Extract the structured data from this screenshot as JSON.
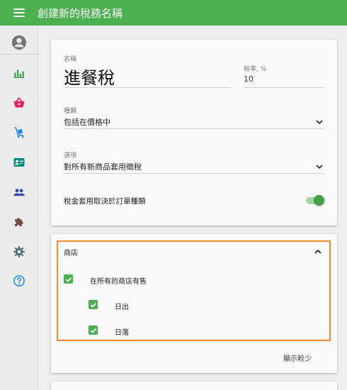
{
  "appbar": {
    "title": "創建新的稅務名稱"
  },
  "form": {
    "name": {
      "label": "名稱",
      "value": "進餐稅"
    },
    "rate": {
      "label": "稅率, %",
      "value": "10"
    },
    "type": {
      "label": "種類",
      "value": "包括在價格中"
    },
    "options": {
      "label": "選項",
      "value": "對所有新商品套用徵稅"
    },
    "toggle": {
      "label": "稅金套用取決於訂單種類",
      "on": true
    }
  },
  "stores": {
    "header": "商店",
    "all": {
      "label": "在所有的商店有售",
      "checked": true
    },
    "items": [
      {
        "label": "日出",
        "checked": true
      },
      {
        "label": "日落",
        "checked": true
      }
    ],
    "show_less": "顯示較少"
  },
  "colors": {
    "primary": "#4caf50",
    "highlight": "#ef8a33"
  },
  "nav_icons": [
    "account-icon",
    "bar-chart-icon",
    "basket-icon",
    "inventory-cart-icon",
    "customer-card-icon",
    "employees-icon",
    "integrations-puzzle-icon",
    "settings-gear-icon",
    "help-icon"
  ]
}
